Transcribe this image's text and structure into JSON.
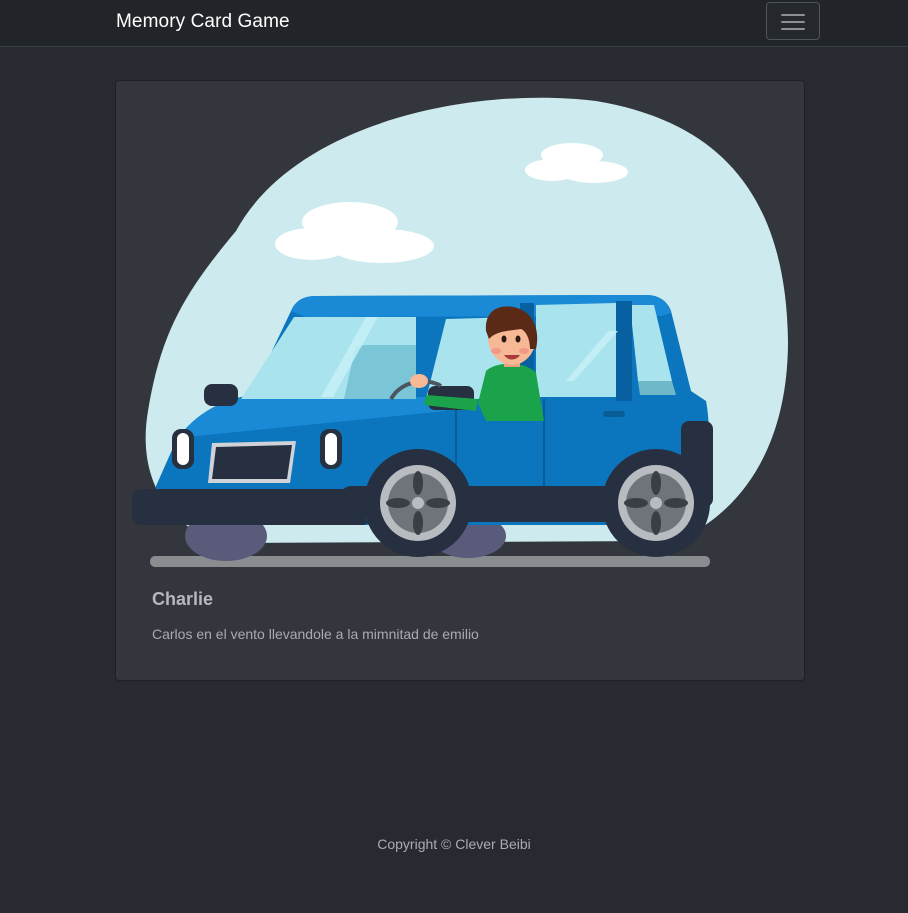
{
  "navbar": {
    "brand": "Memory Card Game",
    "toggler_icon": "hamburger-menu-icon"
  },
  "card": {
    "image_subject": "cartoon man driving a blue car",
    "title": "Charlie",
    "text": "Carlos en el vento llevandole a la mimnitad de emilio"
  },
  "footer": {
    "copyright": "Copyright © Clever Beibi"
  },
  "colors": {
    "page_background": "#272a30",
    "navbar_background": "#212529",
    "card_background": "#33363d",
    "sky_blob": "#cdebee",
    "car_body": "#0b76bd",
    "car_body_light": "#1a8ad6",
    "shirt": "#1aa34a"
  }
}
